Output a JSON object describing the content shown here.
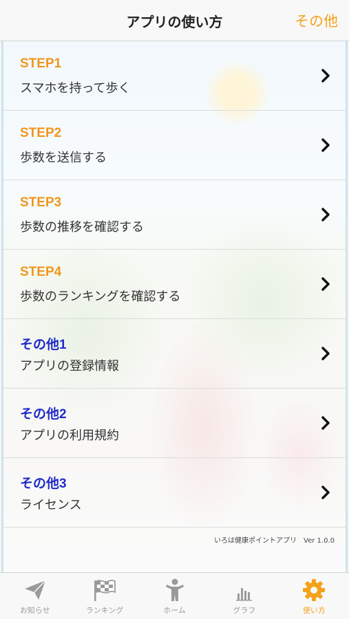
{
  "navbar": {
    "title": "アプリの使い方",
    "right": "その他"
  },
  "menu": [
    {
      "step": "STEP1",
      "desc": "スマホを持って歩く",
      "color": "orange"
    },
    {
      "step": "STEP2",
      "desc": "歩数を送信する",
      "color": "orange"
    },
    {
      "step": "STEP3",
      "desc": "歩数の推移を確認する",
      "color": "orange"
    },
    {
      "step": "STEP4",
      "desc": "歩数のランキングを確認する",
      "color": "orange"
    },
    {
      "step": "その他1",
      "desc": "アプリの登録情報",
      "color": "blue"
    },
    {
      "step": "その他2",
      "desc": "アプリの利用規約",
      "color": "blue"
    },
    {
      "step": "その他3",
      "desc": "ライセンス",
      "color": "blue"
    }
  ],
  "version": "いろは健康ポイントアプリ　Ver 1.0.0",
  "tabs": [
    {
      "label": "お知らせ",
      "icon": "paper-plane-icon"
    },
    {
      "label": "ランキング",
      "icon": "checkered-flag-icon"
    },
    {
      "label": "ホーム",
      "icon": "person-icon"
    },
    {
      "label": "グラフ",
      "icon": "bar-chart-icon"
    },
    {
      "label": "使い方",
      "icon": "gear-icon",
      "active": true
    }
  ],
  "colors": {
    "accent": "#f5a21b",
    "step_orange": "#f0961a",
    "other_blue": "#1f2bc9"
  }
}
